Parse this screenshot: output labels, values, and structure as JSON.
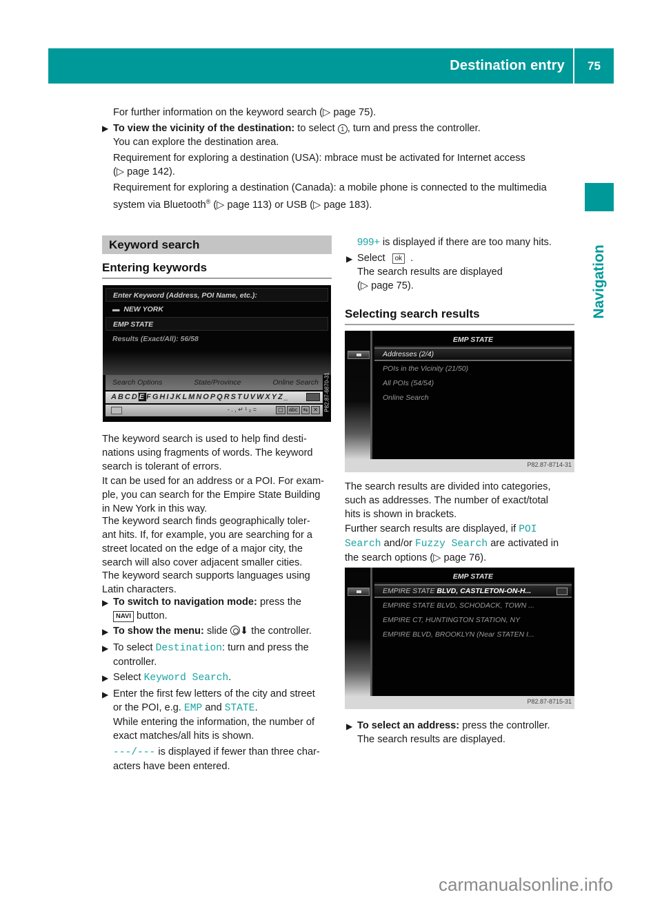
{
  "header": {
    "section_title": "Destination entry",
    "page_number": "75",
    "accent_color": "#009999"
  },
  "side_tab": {
    "label": "Navigation"
  },
  "intro": {
    "line1": "For further information on the keyword search (",
    "line1_ref": "page 75",
    "step1_bold": "To view the vicinity of the destination:",
    "step1_text_a": " to select ",
    "step1_marker": "1",
    "step1_text_b": ", turn and press the controller.",
    "line3": "You can explore the destination area.",
    "line4": "Requirement for exploring a destination (USA): mbrace must be activated for Internet access",
    "line4_ref": "page 142",
    "line5": "Requirement for exploring a destination (Canada): a mobile phone is connected to the multimedia",
    "line6_a": "system via Bluetooth",
    "line6_reg": "®",
    "line6_ref1": "page 113",
    "line6_mid": ") or USB (",
    "line6_ref2": "page 183"
  },
  "left_column": {
    "section_title": "Keyword search",
    "subheading": "Entering keywords",
    "screen1": {
      "prompt": "Enter Keyword (Address, POI Name, etc.):",
      "location": "NEW YORK",
      "input_value": "EMP STATE",
      "results": "Results (Exact/All): 56/58",
      "tabs": [
        "Search Options",
        "State/Province",
        "Online Search"
      ],
      "keyboard_letters_before": "ABCD",
      "keyboard_selected": "E",
      "keyboard_letters_after": "FGHIJKLMNOPQRSTUVWXYZ_",
      "bottom_symbols": "- . ,  ↵ ¹ ₂ =",
      "bottom_tools": [
        "▢",
        "abc",
        "⇆",
        "✕"
      ],
      "image_id": "P82.87-6870-31"
    },
    "paragraphs": [
      [
        "The keyword search is used to help find desti-",
        "nations using fragments of words. The keyword",
        "search is tolerant of errors."
      ],
      [
        "It can be used for an address or a POI. For exam-",
        "ple, you can search for the Empire State Building",
        "in New York in this way."
      ],
      [
        "The keyword search finds geographically toler-",
        "ant hits. If, for example, you are searching for a",
        "street located on the edge of a major city, the",
        "search will also cover adjacent smaller cities."
      ],
      [
        "The keyword search supports languages using",
        "Latin characters."
      ]
    ],
    "steps": {
      "s1_bold": "To switch to navigation mode:",
      "s1_text": " press the",
      "s1_key": "NAVI",
      "s1_text2": " button.",
      "s2_bold": "To show the menu:",
      "s2_text_a": " slide ",
      "s2_text_b": " the controller.",
      "s3_text_a": "To select ",
      "s3_code": "Destination",
      "s3_text_b": ": turn and press the",
      "s3_text_c": "controller.",
      "s4_text": "Select ",
      "s4_code": "Keyword Search",
      "s5_line1": "Enter the first few letters of the city and street",
      "s5_line2_a": "or the POI, e.g. ",
      "s5_code1": "EMP",
      "s5_line2_b": " and ",
      "s5_code2": "STATE",
      "s5_line3": "While entering the information, the number of",
      "s5_line4": "exact matches/all hits is shown.",
      "s5_code3": "---/---",
      "s5_line5": " is displayed if fewer than three char-",
      "s5_line6": "acters have been entered."
    }
  },
  "right_column": {
    "top_code": "999+",
    "top_text": " is displayed if there are too many hits.",
    "select_text": "Select",
    "ok_key": "ok",
    "result_line1": "The search results are displayed",
    "result_ref": "page 75",
    "subheading": "Selecting search results",
    "screen2": {
      "title": "EMP STATE",
      "items": [
        "Addresses (2/4)",
        "POIs in the Vicinity (21/50)",
        "All POIs (54/54)",
        "Online Search"
      ],
      "image_id": "P82.87-8714-31"
    },
    "para1": [
      "The search results are divided into categories,",
      "such as addresses. The number of exact/total",
      "hits is shown in brackets."
    ],
    "para2_a": "Further search results are displayed, if ",
    "para2_code1a": "POI",
    "para2_code1b": "Search",
    "para2_b": " and/or ",
    "para2_code2": "Fuzzy Search",
    "para2_c": " are activated in",
    "para2_d": "the search options (",
    "para2_ref": "page 76",
    "screen3": {
      "title": "EMP STATE",
      "items": [
        {
          "lo": "EMPIRE STATE",
          "hi": " BLVD, CASTLETON-ON-H..."
        },
        {
          "lo": "EMPIRE STATE BLVD, SCHODACK, TOWN ...",
          "hi": ""
        },
        {
          "lo": "EMPIRE CT, HUNTINGTON STATION, NY",
          "hi": ""
        },
        {
          "lo": "EMPIRE BLVD, BROOKLYN (Near STATEN I...",
          "hi": ""
        }
      ],
      "image_id": "P82.87-8715-31"
    },
    "final_bold": "To select an address:",
    "final_text": " press the controller.",
    "final_line2": "The search results are displayed."
  },
  "watermark": "carmanualsonline.info"
}
